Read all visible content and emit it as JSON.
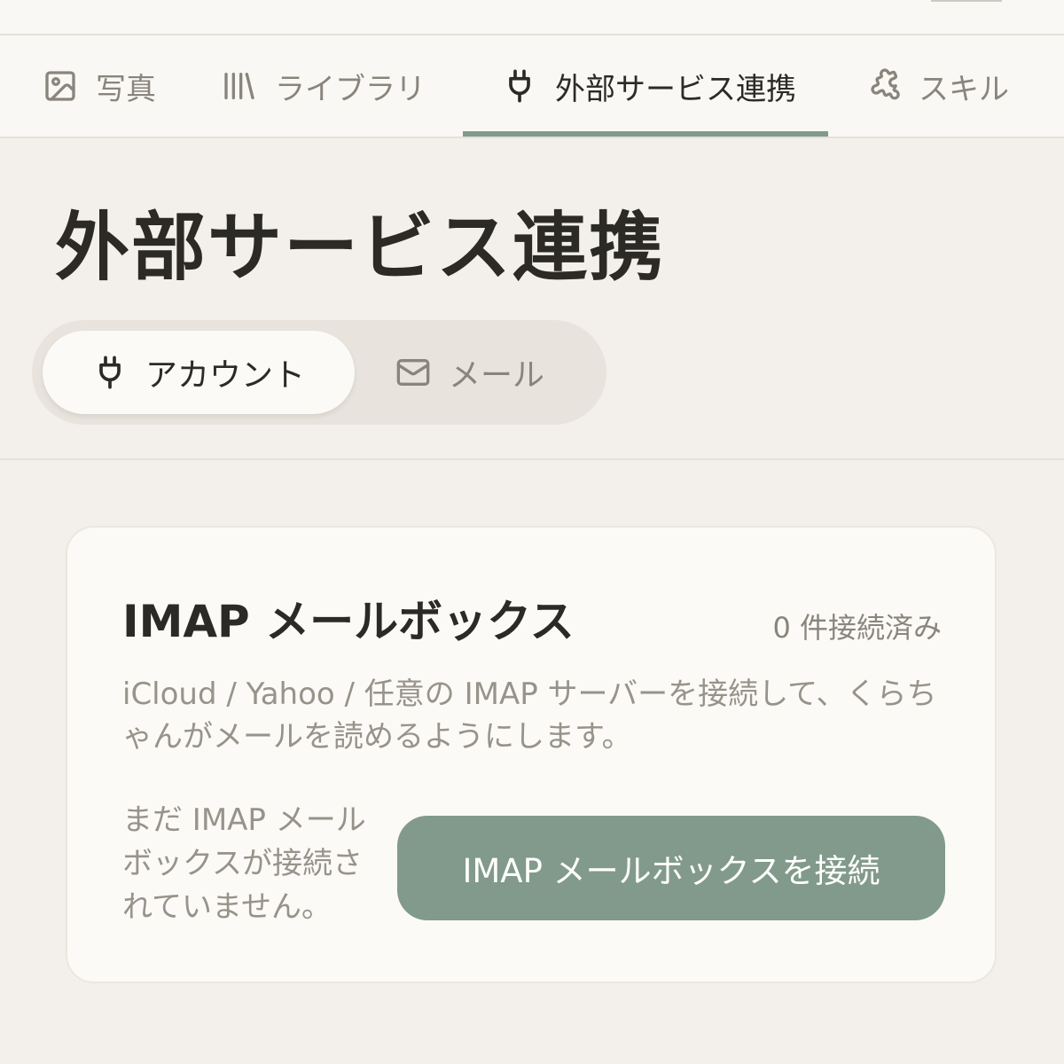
{
  "nav": {
    "tabs": [
      {
        "label": "写真",
        "icon": "image-icon"
      },
      {
        "label": "ライブラリ",
        "icon": "library-icon"
      },
      {
        "label": "外部サービス連携",
        "icon": "plug-icon",
        "active": true
      },
      {
        "label": "スキル",
        "icon": "puzzle-icon"
      }
    ]
  },
  "page": {
    "title": "外部サービス連携"
  },
  "segments": [
    {
      "label": "アカウント",
      "icon": "plug-icon",
      "active": true
    },
    {
      "label": "メール",
      "icon": "mail-icon"
    }
  ],
  "card": {
    "title": "IMAP メールボックス",
    "count": "0 件接続済み",
    "description": "iCloud / Yahoo / 任意の IMAP サーバーを接続して、くらちゃんがメールを読めるようにします。",
    "empty_text": "まだ IMAP メールボックスが接続されていません。",
    "connect_button": "IMAP メールボックスを接続"
  },
  "colors": {
    "accent": "#829a8b",
    "background": "#f3f0eb",
    "surface": "#fbfaf7",
    "text": "#2b2a27",
    "muted_text": "#8a857c"
  }
}
